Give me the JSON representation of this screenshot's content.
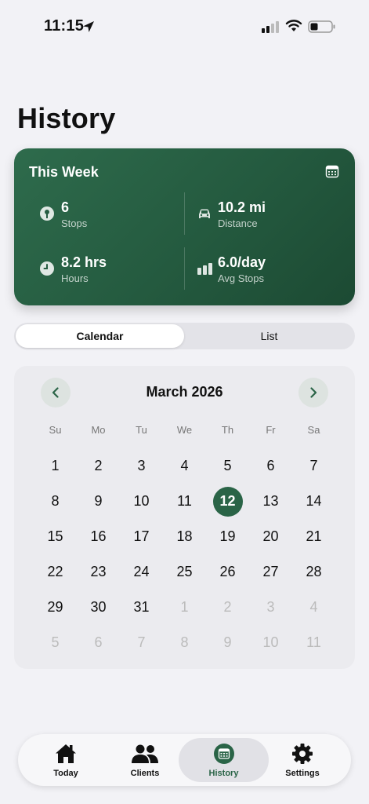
{
  "status_bar": {
    "time": "11:15"
  },
  "page": {
    "title": "History"
  },
  "week_summary": {
    "title": "This Week",
    "stops": {
      "value": "6",
      "label": "Stops"
    },
    "distance": {
      "value": "10.2 mi",
      "label": "Distance"
    },
    "hours": {
      "value": "8.2 hrs",
      "label": "Hours"
    },
    "avg_stops": {
      "value": "6.0/day",
      "label": "Avg Stops"
    }
  },
  "view_toggle": {
    "options": [
      "Calendar",
      "List"
    ],
    "selected": "Calendar"
  },
  "calendar": {
    "month_title": "March 2026",
    "weekdays": [
      "Su",
      "Mo",
      "Tu",
      "We",
      "Th",
      "Fr",
      "Sa"
    ],
    "selected_day": "12",
    "weeks": [
      [
        "1",
        "2",
        "3",
        "4",
        "5",
        "6",
        "7"
      ],
      [
        "8",
        "9",
        "10",
        "11",
        "12",
        "13",
        "14"
      ],
      [
        "15",
        "16",
        "17",
        "18",
        "19",
        "20",
        "21"
      ],
      [
        "22",
        "23",
        "24",
        "25",
        "26",
        "27",
        "28"
      ],
      [
        "29",
        "30",
        "31",
        "1",
        "2",
        "3",
        "4"
      ],
      [
        "5",
        "6",
        "7",
        "8",
        "9",
        "10",
        "11"
      ]
    ],
    "outside_month_from_week4_index": 3
  },
  "tab_bar": {
    "tabs": [
      {
        "label": "Today",
        "icon": "house-icon"
      },
      {
        "label": "Clients",
        "icon": "people-icon"
      },
      {
        "label": "History",
        "icon": "calendar-icon"
      },
      {
        "label": "Settings",
        "icon": "gear-icon"
      }
    ],
    "active": "History"
  },
  "colors": {
    "accent": "#2a6447",
    "card_gradient_start": "#2e6b4c",
    "card_gradient_end": "#1c4a33"
  }
}
